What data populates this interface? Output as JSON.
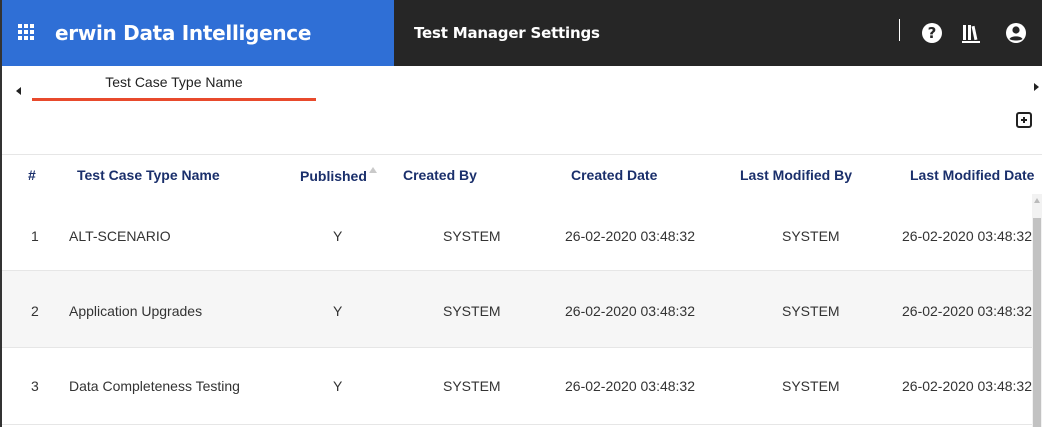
{
  "header": {
    "app_title": "erwin Data Intelligence",
    "page_title": "Test Manager Settings",
    "help_glyph": "?",
    "icons": [
      "grid-menu-icon",
      "help-icon",
      "library-icon",
      "user-icon"
    ]
  },
  "tabs": [
    {
      "label": "Test Case Type Name",
      "active": true
    }
  ],
  "table": {
    "columns": [
      "#",
      "Test Case Type Name",
      "Published",
      "Created By",
      "Created Date",
      "Last Modified By",
      "Last Modified Date"
    ],
    "rows": [
      {
        "num": "1",
        "name": "ALT-SCENARIO",
        "published": "Y",
        "created_by": "SYSTEM",
        "created_date": "26-02-2020 03:48:32",
        "modified_by": "SYSTEM",
        "modified_date": "26-02-2020 03:48:32"
      },
      {
        "num": "2",
        "name": "Application Upgrades",
        "published": "Y",
        "created_by": "SYSTEM",
        "created_date": "26-02-2020 03:48:32",
        "modified_by": "SYSTEM",
        "modified_date": "26-02-2020 03:48:32"
      },
      {
        "num": "3",
        "name": "Data Completeness Testing",
        "published": "Y",
        "created_by": "SYSTEM",
        "created_date": "26-02-2020 03:48:32",
        "modified_by": "SYSTEM",
        "modified_date": "26-02-2020 03:48:32"
      }
    ]
  },
  "colors": {
    "brand_blue": "#2f6fd6",
    "header_dark": "#262626",
    "tab_underline": "#e84a2c",
    "column_header_text": "#1a2f6b"
  }
}
